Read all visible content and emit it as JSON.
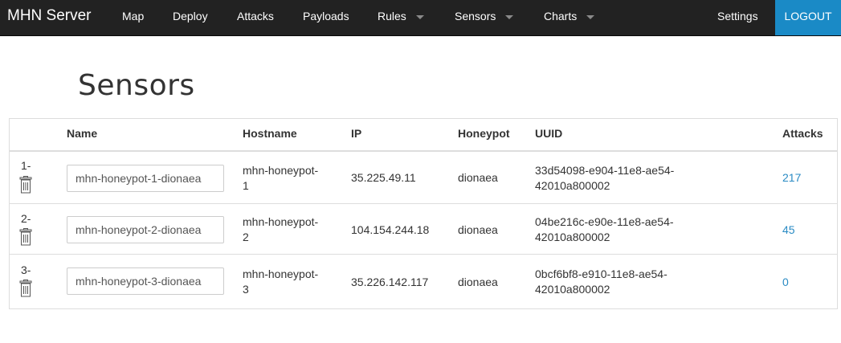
{
  "navbar": {
    "brand": "MHN Server",
    "items": [
      {
        "label": "Map",
        "dropdown": false
      },
      {
        "label": "Deploy",
        "dropdown": false
      },
      {
        "label": "Attacks",
        "dropdown": false
      },
      {
        "label": "Payloads",
        "dropdown": false
      },
      {
        "label": "Rules",
        "dropdown": true
      },
      {
        "label": "Sensors",
        "dropdown": true
      },
      {
        "label": "Charts",
        "dropdown": true
      }
    ],
    "settings": "Settings",
    "logout": "LOGOUT",
    "colors": {
      "background": "#222222",
      "logout": "#1a8ac6"
    }
  },
  "page": {
    "title": "Sensors"
  },
  "table": {
    "headers": [
      "Name",
      "Hostname",
      "IP",
      "Honeypot",
      "UUID",
      "Attacks"
    ],
    "rows": [
      {
        "index": "1-",
        "name": "mhn-honeypot-1-dionaea",
        "hostname_1": "mhn-honeypot-",
        "hostname_2": "1",
        "ip": "35.225.49.11",
        "honeypot": "dionaea",
        "uuid_1": "33d54098-e904-11e8-ae54-",
        "uuid_2": "42010a800002",
        "attacks": "217"
      },
      {
        "index": "2-",
        "name": "mhn-honeypot-2-dionaea",
        "hostname_1": "mhn-honeypot-",
        "hostname_2": "2",
        "ip": "104.154.244.18",
        "honeypot": "dionaea",
        "uuid_1": "04be216c-e90e-11e8-ae54-",
        "uuid_2": "42010a800002",
        "attacks": "45"
      },
      {
        "index": "3-",
        "name": "mhn-honeypot-3-dionaea",
        "hostname_1": "mhn-honeypot-",
        "hostname_2": "3",
        "ip": "35.226.142.117",
        "honeypot": "dionaea",
        "uuid_1": "0bcf6bf8-e910-11e8-ae54-",
        "uuid_2": "42010a800002",
        "attacks": "0"
      }
    ],
    "link_color": "#2a8bc4"
  }
}
